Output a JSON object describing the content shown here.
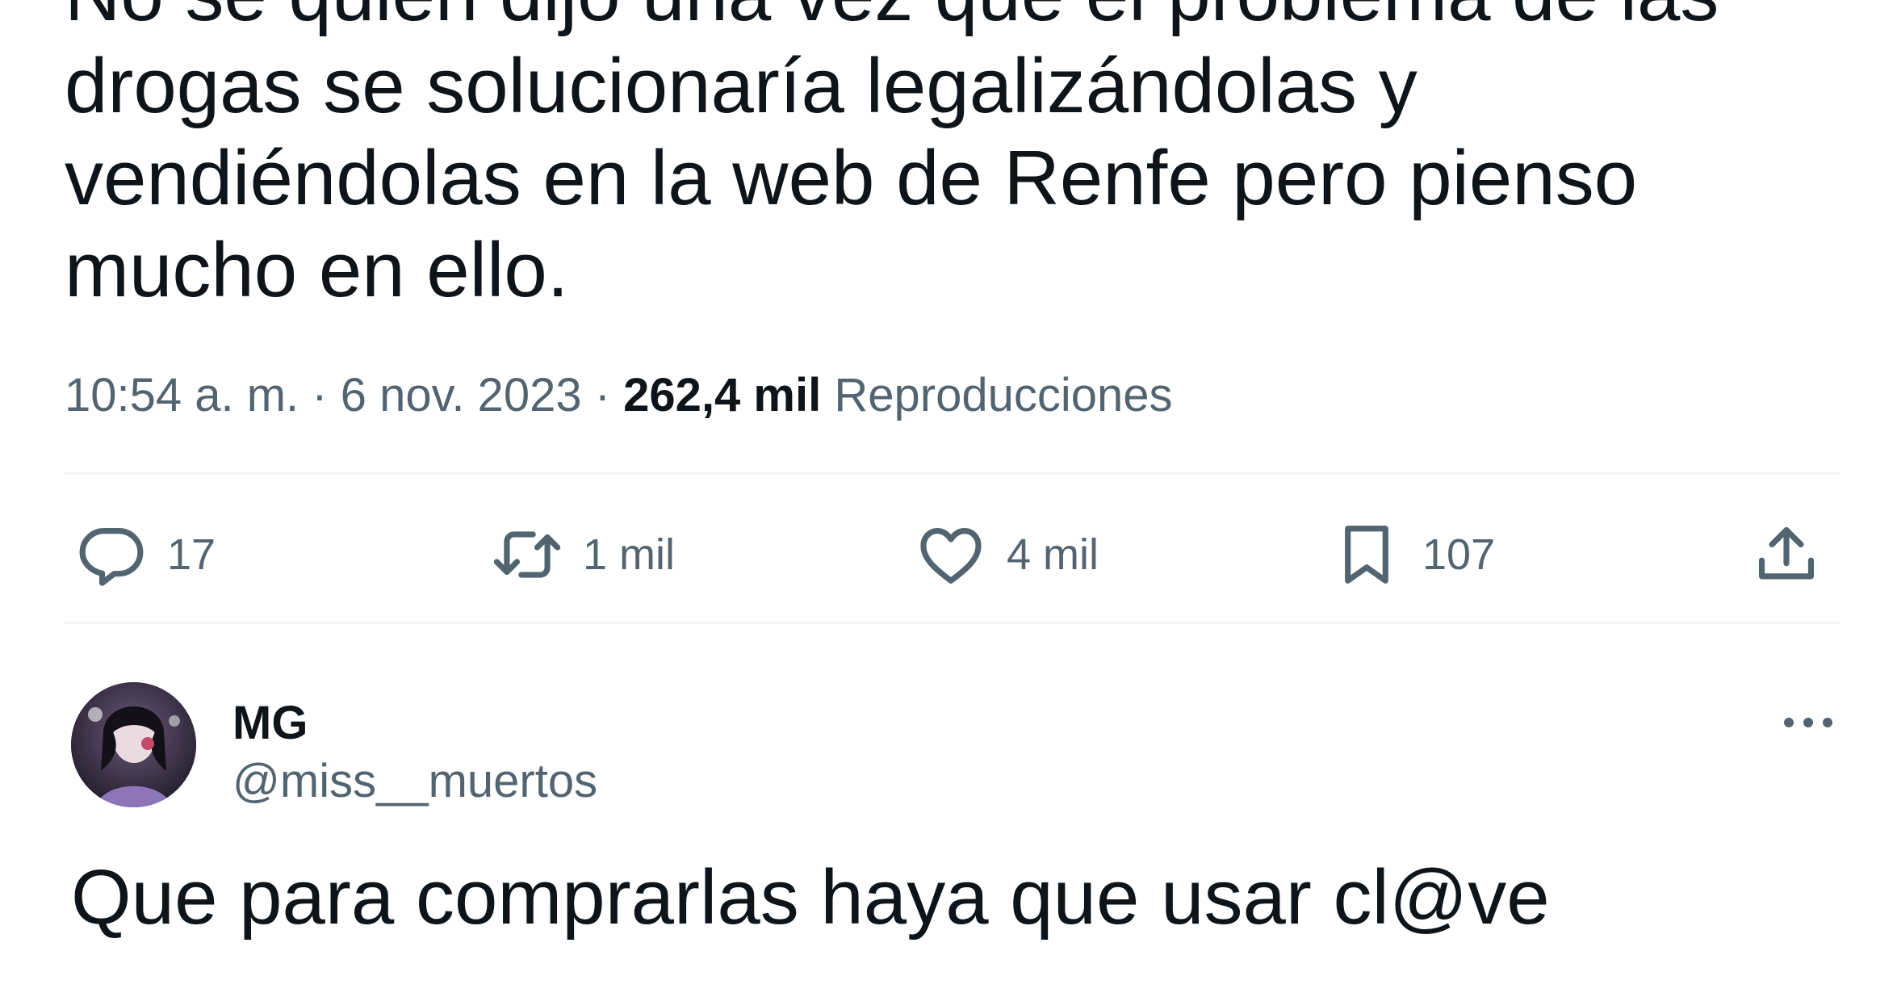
{
  "tweet": {
    "text_lines": [
      "No sé quién dijo una vez que el problema de las",
      "drogas se solucionaría legalizándolas y",
      "vendiéndolas en la web de Renfe pero pienso",
      "mucho en ello."
    ],
    "time": "10:54 a. m.",
    "separator": "·",
    "date": "6 nov. 2023",
    "views_count": "262,4 mil",
    "views_label": "Reproducciones"
  },
  "actions": {
    "replies": {
      "icon": "reply-icon",
      "count": "17"
    },
    "retweets": {
      "icon": "retweet-icon",
      "count": "1 mil"
    },
    "likes": {
      "icon": "heart-icon",
      "count": "4 mil"
    },
    "bookmarks": {
      "icon": "bookmark-icon",
      "count": "107"
    },
    "share": {
      "icon": "share-icon"
    }
  },
  "reply": {
    "display_name": "MG",
    "handle": "@miss__muertos",
    "text": "Que para comprarlas haya que usar cl@ve",
    "more_icon": "more-options-icon"
  },
  "colors": {
    "text_primary": "#0f1419",
    "text_secondary": "#536471",
    "divider": "#eff3f4"
  }
}
